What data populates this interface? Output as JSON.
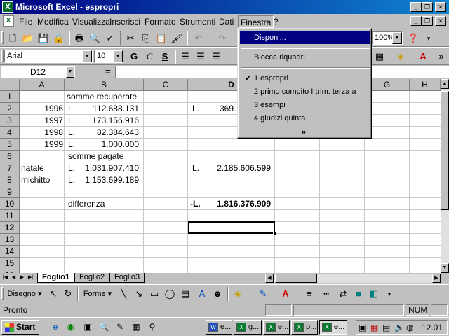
{
  "window": {
    "title": "Microsoft Excel - espropri",
    "app_icon": "excel-icon"
  },
  "menubar": {
    "items": [
      "File",
      "Modifica",
      "Visualizza",
      "Inserisci",
      "Formato",
      "Strumenti",
      "Dati",
      "Finestra",
      "?"
    ],
    "active": "Finestra"
  },
  "toolbar_standard": {
    "zoom": "100%"
  },
  "toolbar_format": {
    "font": "Arial",
    "size": "10",
    "bold": "G",
    "italic": "C",
    "underline": "S"
  },
  "formula_bar": {
    "name_box": "D12",
    "eq": "=",
    "content": ""
  },
  "columns": [
    "A",
    "B",
    "C",
    "D",
    "E",
    "F",
    "G",
    "H"
  ],
  "rows": [
    "1",
    "2",
    "3",
    "4",
    "5",
    "6",
    "7",
    "8",
    "9",
    "10",
    "11",
    "12",
    "13",
    "14",
    "15",
    "16"
  ],
  "selected_cell": "D12",
  "cells": {
    "B1": "somme recuperate",
    "A2": "1996",
    "B2_cur": "L.",
    "B2": "112.688.131",
    "D2_cur": "L.",
    "D2": "369.",
    "A3": "1997",
    "B3_cur": "L.",
    "B3": "173.156.916",
    "A4": "1998",
    "B4_cur": "L.",
    "B4": "82.384.643",
    "A5": "1999",
    "B5_cur": "L.",
    "B5": "1.000.000",
    "B6": "somme pagate",
    "A7": "natale",
    "B7_cur": "L.",
    "B7": "1.031.907.410",
    "D7_cur": "L.",
    "D7": "2.185.606.599",
    "A8": "michitto",
    "B8_cur": "L.",
    "B8": "1.153.699.189",
    "B10": "differenza",
    "D10_cur": "-L.",
    "D10": "1.816.376.909"
  },
  "sheet_tabs": [
    "Foglio1",
    "Foglio2",
    "Foglio3"
  ],
  "active_tab": "Foglio1",
  "drawing_toolbar": {
    "draw_label": "Disegno",
    "shapes_label": "Forme"
  },
  "statusbar": {
    "status": "Pronto",
    "num": "NUM"
  },
  "finestra_menu": {
    "items": [
      {
        "label": "Disponi...",
        "highlighted": true
      },
      {
        "label": "Blocca riquadri"
      },
      {
        "label": "1 espropri",
        "checked": true
      },
      {
        "label": "2 primo compito I trim. terza a"
      },
      {
        "label": "3 esempi"
      },
      {
        "label": "4 giudizi quinta"
      }
    ],
    "expand": "»"
  },
  "taskbar": {
    "start": "Start",
    "buttons": [
      {
        "label": "e...",
        "icon": "word-icon"
      },
      {
        "label": "g...",
        "icon": "excel-icon"
      },
      {
        "label": "e...",
        "icon": "excel-icon"
      },
      {
        "label": "p...",
        "icon": "excel-icon"
      },
      {
        "label": "e...",
        "icon": "excel-icon",
        "active": true
      }
    ],
    "clock": "12.01"
  }
}
